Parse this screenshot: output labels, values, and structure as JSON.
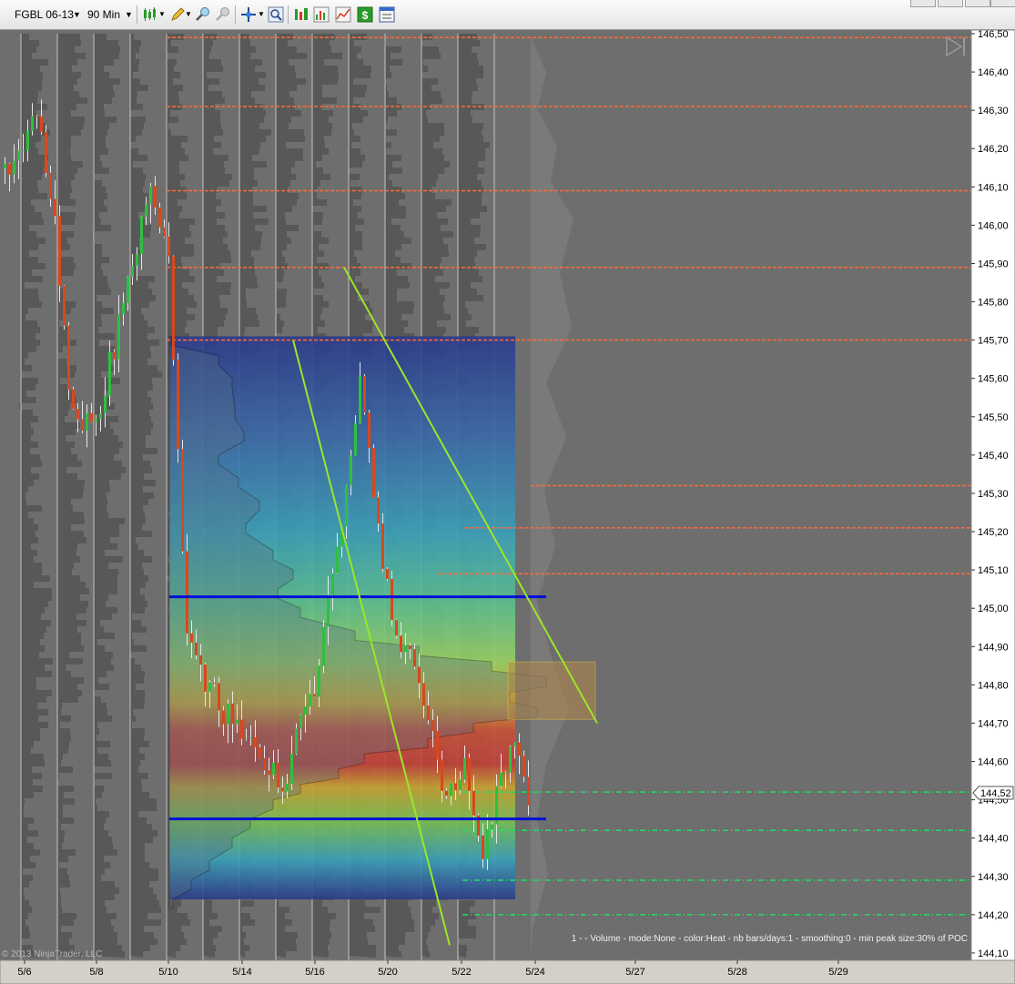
{
  "toolbar": {
    "instrument": "FGBL 06-13",
    "interval": "90 Min",
    "icons": [
      "candlestick-icon",
      "pencil-icon",
      "zoom-in-icon",
      "zoom-out-icon",
      "crosshair-icon",
      "magnify-icon",
      "strategy-icon",
      "indicator-icon",
      "dollar-icon",
      "properties-icon"
    ]
  },
  "chart_data": {
    "type": "candlestick",
    "instrument": "FGBL 06-13",
    "interval": "90 Min",
    "y_ticks": [
      "146,50",
      "146,40",
      "146,30",
      "146,20",
      "146,10",
      "146,00",
      "145,90",
      "145,80",
      "145,70",
      "145,60",
      "145,50",
      "145,40",
      "145,30",
      "145,20",
      "145,10",
      "145,00",
      "144,90",
      "144,80",
      "144,70",
      "144,60",
      "144,50",
      "144,40",
      "144,30",
      "144,20",
      "144,10"
    ],
    "ylim": [
      144.1,
      146.5
    ],
    "x_ticks": [
      "5/6",
      "5/8",
      "5/10",
      "5/14",
      "5/16",
      "5/20",
      "5/22",
      "5/24",
      "5/27",
      "5/28",
      "5/29"
    ],
    "last_price": "144,52",
    "value_area": {
      "high": 145.03,
      "low": 144.45
    },
    "poc_box": {
      "high": 144.86,
      "low": 144.71
    },
    "levels": {
      "orange": [
        146.49,
        146.31,
        146.09,
        145.89,
        145.7,
        145.32,
        145.21,
        145.09
      ],
      "green": [
        144.52,
        144.42,
        144.29,
        144.2
      ]
    },
    "trendlines": [
      {
        "from": [
          "5/15",
          145.7
        ],
        "to": [
          "5/21",
          144.12
        ]
      },
      {
        "from": [
          "5/17",
          145.89
        ],
        "to": [
          "5/25",
          144.7
        ]
      }
    ],
    "footer_text": "1 -  - Volume - mode:None - color:Heat - nb bars/days:1 - smoothing:0 - min peak size:30% of POC",
    "copyright": "© 2013 NinjaTrader, LLC",
    "colors": {
      "orange": "#ff6a3a",
      "green": "#22dd66",
      "blue": "#0010d8",
      "trend": "#9ae62a",
      "bg": "#6e6e6e"
    }
  }
}
